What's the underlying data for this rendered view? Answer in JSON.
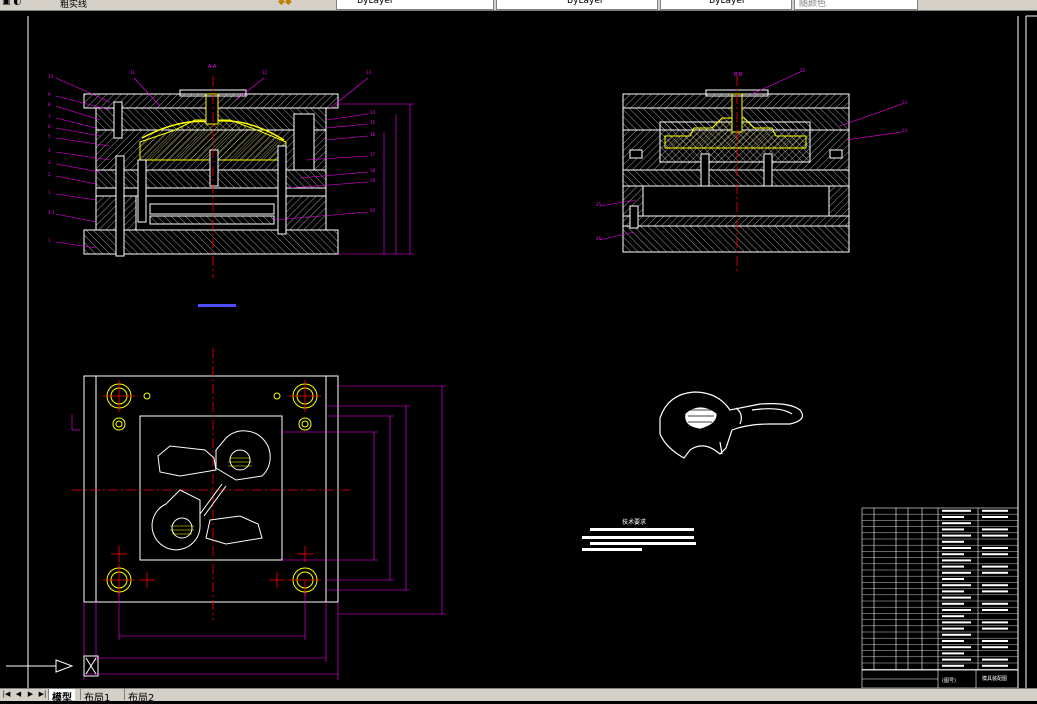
{
  "toolbar": {
    "layer_label": "粗实线",
    "dropdowns": [
      "ByLayer",
      "ByLayer",
      "ByLayer",
      "随颜色"
    ]
  },
  "drawing": {
    "section_aa": "A-A",
    "section_bb": "B-B",
    "tech_req_title": "技术要求",
    "balloons_left_side": [
      "13",
      "9",
      "8",
      "7",
      "6",
      "5",
      "4",
      "3",
      "2",
      "1",
      "2-1",
      "1"
    ],
    "balloons_top": [
      "11",
      "12",
      "13"
    ],
    "balloons_right_side": [
      "14",
      "15",
      "16",
      "17",
      "18",
      "19",
      "20"
    ],
    "balloons_view2": [
      "22",
      "23",
      "24",
      "25",
      "26"
    ]
  },
  "titleblock": {
    "stamp": "(图号)",
    "name": "模具装配图"
  },
  "tabs": [
    "模型",
    "布局1",
    "布局2"
  ],
  "colors": {
    "background": "#000000",
    "outline": "#ffffff",
    "hatch": "#ffffff",
    "centerline": "#ff0000",
    "dimension": "#ff00ff",
    "part": "#ffff00",
    "text_blue": "#6f6fff"
  }
}
